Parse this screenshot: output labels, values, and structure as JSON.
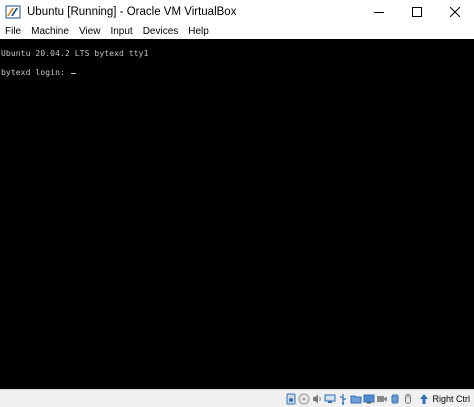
{
  "window": {
    "title": "Ubuntu [Running] - Oracle VM VirtualBox",
    "app_icon": "virtualbox-icon"
  },
  "controls": {
    "minimize": "minimize-icon",
    "maximize": "maximize-icon",
    "close": "close-icon"
  },
  "menu": {
    "items": [
      {
        "label": "File"
      },
      {
        "label": "Machine"
      },
      {
        "label": "View"
      },
      {
        "label": "Input"
      },
      {
        "label": "Devices"
      },
      {
        "label": "Help"
      }
    ]
  },
  "console": {
    "line1": "Ubuntu 20.04.2 LTS bytexd tty1",
    "line2": "bytexd login: "
  },
  "statusbar": {
    "icons": [
      "hard-disk-icon",
      "optical-drive-icon",
      "audio-icon",
      "network-icon",
      "usb-icon",
      "shared-folders-icon",
      "display-icon",
      "video-capture-icon",
      "cpu-icon",
      "mouse-integration-icon"
    ],
    "host_key": "Right Ctrl",
    "host_key_icon": "keyboard-arrow-icon",
    "colors": {
      "status_bg": "#f0f0f0",
      "console_bg": "#000000",
      "console_text": "#c8c8c8",
      "accent_blue": "#2f6fb7"
    }
  }
}
